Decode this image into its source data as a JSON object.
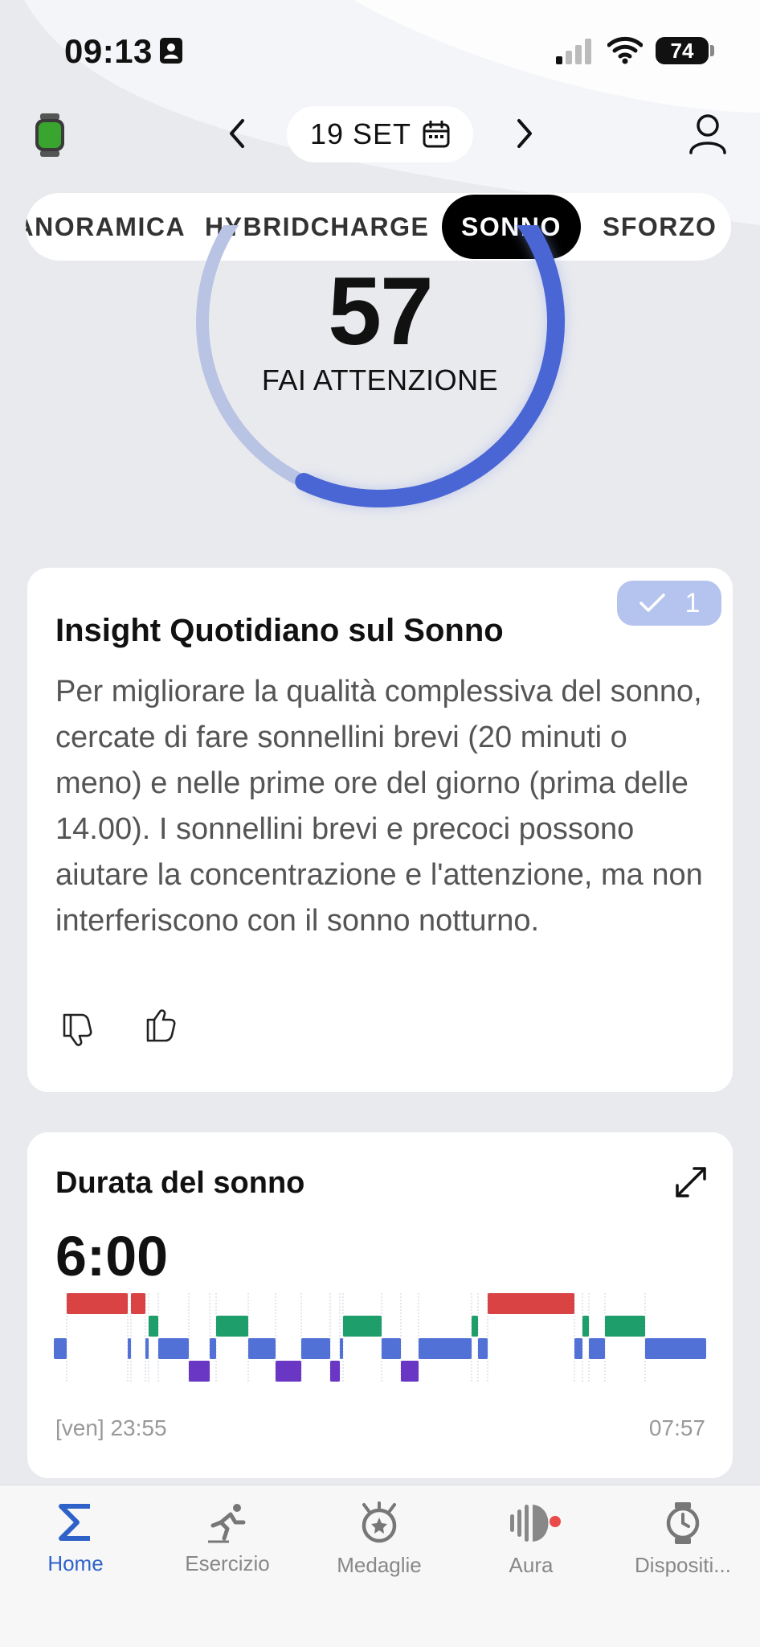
{
  "status": {
    "time": "09:13",
    "battery": "74"
  },
  "header": {
    "date": "19 SET"
  },
  "tabs": [
    {
      "label": "PANORAMICA"
    },
    {
      "label": "HYBRIDCHARGE"
    },
    {
      "label": "SONNO",
      "active": true
    },
    {
      "label": "SFORZO"
    }
  ],
  "score": {
    "value": "57",
    "label": "FAI ATTENZIONE",
    "fraction": 0.57
  },
  "insight": {
    "badge_count": "1",
    "title": "Insight Quotidiano sul Sonno",
    "text": "Per migliorare la qualità complessiva del sonno, cercate di fare sonnellini brevi (20 minuti o meno) e nelle prime ore del giorno (prima delle 14.00). I sonnellini brevi e precoci possono aiutare la concentrazione e l'attenzione, ma non interferiscono con il sonno notturno."
  },
  "sleep": {
    "title": "Durata del sonno",
    "duration": "6:00",
    "start_label": "[ven] 23:55",
    "end_label": "07:57"
  },
  "colors": {
    "awake": "#d94343",
    "rem": "#1e9e6a",
    "light": "#5271d6",
    "deep": "#6a36c4",
    "accent": "#2f62c9"
  },
  "nav": [
    {
      "label": "Home",
      "icon": "sigma-icon",
      "active": true
    },
    {
      "label": "Esercizio",
      "icon": "runner-icon"
    },
    {
      "label": "Medaglie",
      "icon": "medal-icon"
    },
    {
      "label": "Aura",
      "icon": "aura-icon",
      "notification": true
    },
    {
      "label": "Dispositi...",
      "icon": "watch-icon"
    }
  ]
}
